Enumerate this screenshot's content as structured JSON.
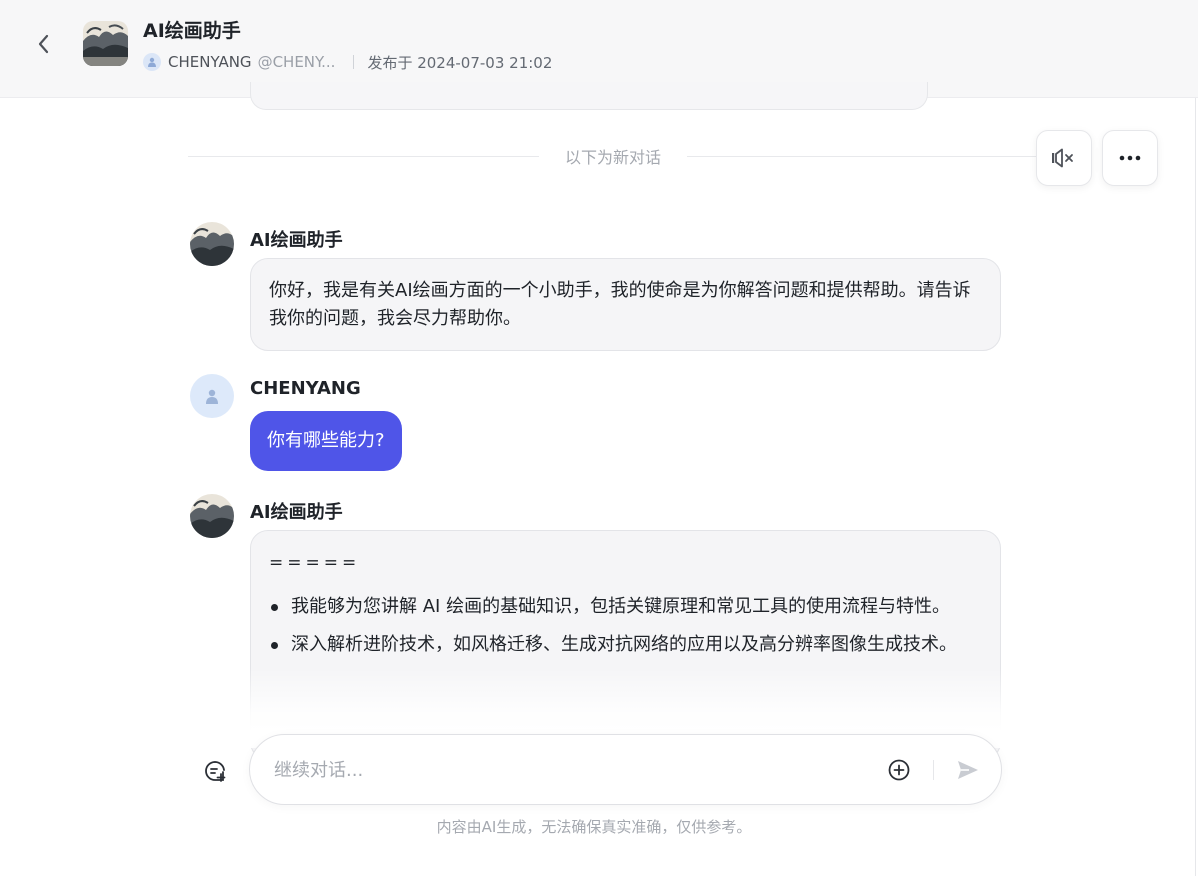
{
  "header": {
    "title": "AI绘画助手",
    "author_name": "CHENYANG",
    "author_handle": "@CHENY...",
    "publish_text": "发布于 2024-07-03 21:02"
  },
  "divider": {
    "text": "以下为新对话"
  },
  "messages": [
    {
      "role": "bot",
      "name": "AI绘画助手",
      "text": "你好，我是有关AI绘画方面的一个小助手，我的使命是为你解答问题和提供帮助。请告诉我你的问题，我会尽力帮助你。"
    },
    {
      "role": "user",
      "name": "CHENYANG",
      "text": "你有哪些能力?"
    },
    {
      "role": "bot",
      "name": "AI绘画助手",
      "lead": "=====",
      "bullets": [
        "我能够为您讲解 AI 绘画的基础知识，包括关键原理和常见工具的使用流程与特性。",
        "深入解析进阶技术，如风格迁移、生成对抗网络的应用以及高分辨率图像生成技术。"
      ]
    }
  ],
  "input": {
    "placeholder": "继续对话..."
  },
  "disclaimer": "内容由AI生成，无法确保真实准确，仅供参考。",
  "icons": {
    "back": "chevron-left-icon",
    "mute": "speaker-muted-icon",
    "more": "more-dots-icon",
    "new_chat": "new-chat-icon",
    "attach": "plus-circle-icon",
    "send": "send-icon"
  },
  "colors": {
    "accent": "#4f55e8",
    "bubble_bg": "#f5f5f7",
    "header_bg": "#f7f7f8"
  }
}
